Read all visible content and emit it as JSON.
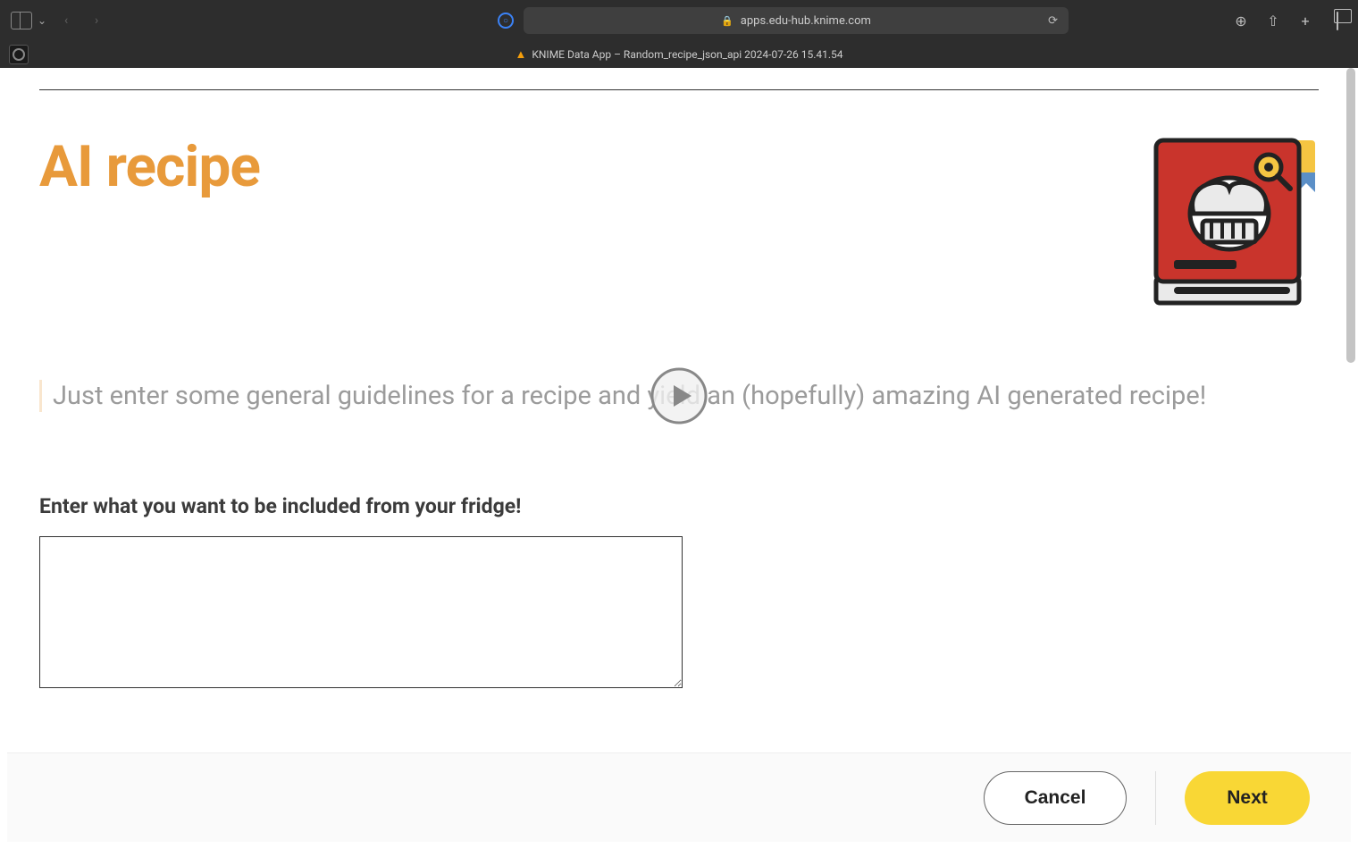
{
  "browser": {
    "url": "apps.edu-hub.knime.com",
    "tab_title": "KNIME Data App – Random_recipe_json_api 2024-07-26 15.41.54"
  },
  "page": {
    "title": "AI recipe",
    "subtitle": "Just enter some general guidelines for a recipe and yield an (hopefully) amazing AI generated recipe!",
    "input_label": "Enter what you want to be included from your fridge!",
    "input_value": "",
    "input_placeholder": ""
  },
  "actions": {
    "cancel": "Cancel",
    "next": "Next"
  },
  "icons": {
    "recipe_book": "recipe-book-icon",
    "play": "play-icon"
  }
}
